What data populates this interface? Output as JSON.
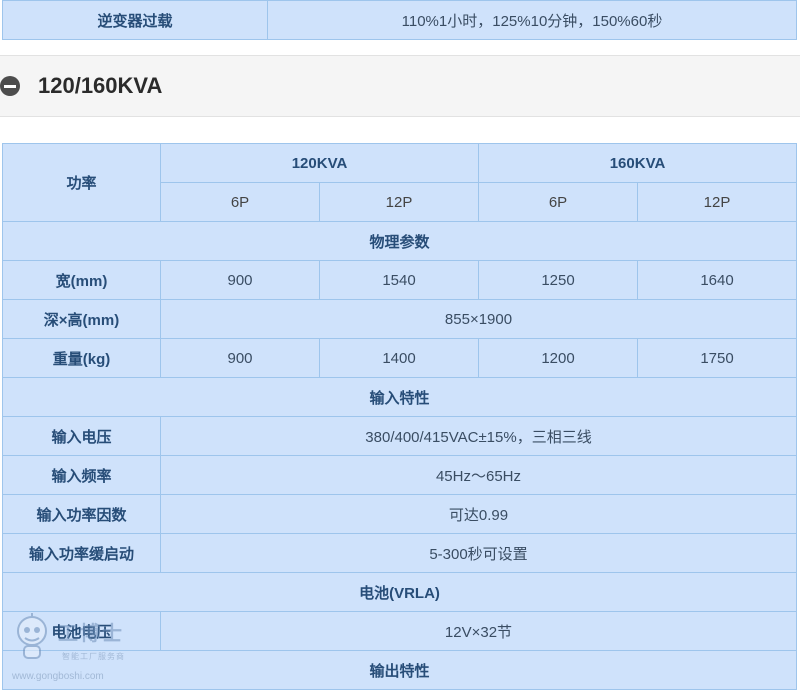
{
  "top_row": {
    "label": "逆变器过载",
    "value": "110%1小时，125%10分钟，150%60秒"
  },
  "section": {
    "title": "120/160KVA",
    "icon": "minus-circle-icon"
  },
  "table": {
    "header": {
      "label": "功率",
      "models": [
        "120KVA",
        "160KVA"
      ],
      "variants": [
        "6P",
        "12P",
        "6P",
        "12P"
      ]
    },
    "groups": {
      "physical": "物理参数",
      "input": "输入特性",
      "battery": "电池(VRLA)",
      "output": "输出特性"
    },
    "rows": {
      "width": {
        "label": "宽(mm)",
        "values": [
          "900",
          "1540",
          "1250",
          "1640"
        ]
      },
      "depth_height": {
        "label": "深×高(mm)",
        "value": "855×1900"
      },
      "weight": {
        "label": "重量(kg)",
        "values": [
          "900",
          "1400",
          "1200",
          "1750"
        ]
      },
      "input_voltage": {
        "label": "输入电压",
        "value": "380/400/415VAC±15%，三相三线"
      },
      "input_frequency": {
        "label": "输入频率",
        "value": "45Hz～65Hz"
      },
      "input_pf": {
        "label": "输入功率因数",
        "value": "可达0.99"
      },
      "input_soft_start": {
        "label": "输入功率缓启动",
        "value": "5-300秒可设置"
      },
      "battery_voltage": {
        "label": "电池电压",
        "value": "12V×32节"
      }
    }
  },
  "watermark": {
    "brand": "工博士",
    "subtitle": "智能工厂服务商",
    "url": "www.gongboshi.com"
  }
}
